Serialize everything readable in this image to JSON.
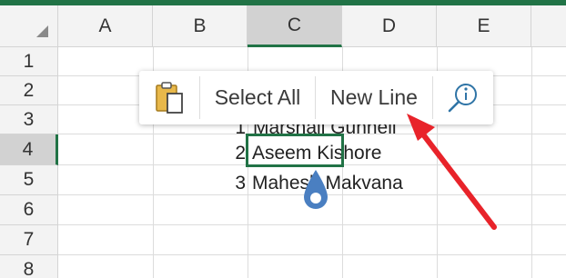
{
  "columns": [
    "A",
    "B",
    "C",
    "D",
    "E"
  ],
  "active_column": "C",
  "rows": [
    "1",
    "2",
    "3",
    "4",
    "5",
    "6",
    "7",
    "8"
  ],
  "active_row": "4",
  "cells": [
    {
      "row": "3",
      "number": "1",
      "name": "Marshall Gunnell"
    },
    {
      "row": "4",
      "number": "2",
      "name": "Aseem Kishore"
    },
    {
      "row": "5",
      "number": "3",
      "name": "Mahesh Makvana"
    }
  ],
  "context_menu": {
    "paste_icon": "clipboard-paste-icon",
    "select_all": "Select All",
    "new_line": "New Line",
    "smart_lookup_icon": "smart-lookup-icon"
  },
  "colors": {
    "accent": "#217346",
    "arrow": "#e8232a",
    "handle": "#4a7fc1"
  }
}
